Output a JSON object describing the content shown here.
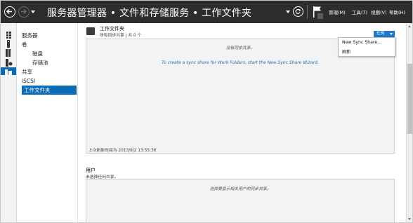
{
  "header": {
    "title": "服务器管理器 • 文件和存储服务 • 工作文件夹",
    "menus": [
      "管理(M)",
      "工具(T)",
      "视图(V)",
      "帮助(H)"
    ]
  },
  "icons": {
    "back": "back-arrow-icon",
    "forward": "forward-arrow-icon",
    "refresh": "refresh-icon",
    "notifications": "flag-icon",
    "strip": [
      "dashboard-icon",
      "local-server-icon",
      "all-servers-icon",
      "roles-icon",
      "file-storage-icon"
    ]
  },
  "nav": {
    "items": [
      {
        "label": "服务器",
        "level": 0
      },
      {
        "label": "卷",
        "level": 0
      },
      {
        "label": "磁盘",
        "level": 1
      },
      {
        "label": "存储池",
        "level": 1
      },
      {
        "label": "共享",
        "level": 0
      },
      {
        "label": "iSCSI",
        "level": 0
      },
      {
        "label": "工作文件夹",
        "level": 0,
        "selected": true
      }
    ]
  },
  "work_folders": {
    "title": "工作文件夹",
    "subtitle": "所有同步共享 | 共 0 个",
    "tasks_label": "任务",
    "empty_message": "没有同步共享。",
    "hint": "To create a sync share for Work Folders, start the New Sync Share Wizard.",
    "last_refresh": "上次刷新时间为 2013/8/2 13:55:36"
  },
  "tasks_menu": {
    "items": [
      "New Sync Share...",
      "刷新"
    ]
  },
  "users": {
    "title": "用户",
    "subtitle": "未选择任何共享。",
    "empty_message": "选择要显示相关用户的同步共享。"
  },
  "colors": {
    "header_bg": "#2d2d30",
    "accent": "#0b6bb5",
    "link": "#1e6fb8",
    "panel_bg": "#f3f3f3"
  }
}
